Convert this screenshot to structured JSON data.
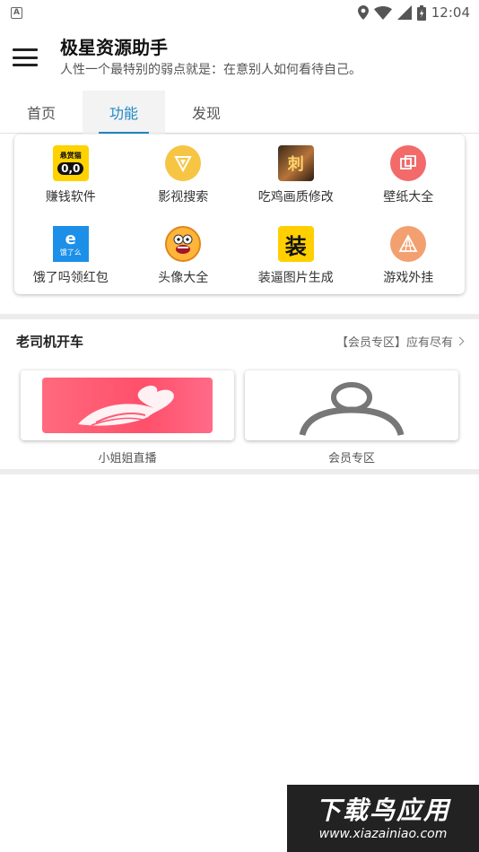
{
  "status_bar": {
    "time": "12:04",
    "left_icon": "a-notification-icon",
    "right_icons": [
      "location-icon",
      "wifi-icon",
      "signal-icon",
      "battery-icon"
    ]
  },
  "header": {
    "menu_icon": "hamburger-menu-icon",
    "title": "极星资源助手",
    "subtitle": "人性一个最特别的弱点就是：在意别人如何看待自己。"
  },
  "tabs": [
    {
      "label": "首页",
      "active": false
    },
    {
      "label": "功能",
      "active": true
    },
    {
      "label": "发现",
      "active": false
    }
  ],
  "colors": {
    "accent": "#1e88c7",
    "divider": "#ececec"
  },
  "features": [
    {
      "label": "赚钱软件",
      "icon": "reward-cat-app-icon"
    },
    {
      "label": "影视搜索",
      "icon": "video-search-icon"
    },
    {
      "label": "吃鸡画质修改",
      "icon": "game-graphics-icon"
    },
    {
      "label": "壁纸大全",
      "icon": "wallpaper-icon"
    },
    {
      "label": "饿了吗领红包",
      "icon": "eleme-app-icon"
    },
    {
      "label": "头像大全",
      "icon": "avatar-face-icon"
    },
    {
      "label": "装逼图片生成",
      "icon": "zhuang-image-icon"
    },
    {
      "label": "游戏外挂",
      "icon": "game-plugin-icon"
    }
  ],
  "feature_icon_text": {
    "money_top": "悬赏猫",
    "money_face": "0,0",
    "game": "刺",
    "eleme_e": "e",
    "eleme_sub": "饿了么",
    "zhuang": "装"
  },
  "section": {
    "title": "老司机开车",
    "more_label": "【会员专区】应有尽有"
  },
  "cards": [
    {
      "label": "小姐姐直播",
      "icon": "woman-silhouette-banner-icon"
    },
    {
      "label": "会员专区",
      "icon": "user-avatar-placeholder-icon"
    }
  ],
  "watermark": {
    "line1": "下载鸟应用",
    "line2": "www.xiazainiao.com"
  }
}
